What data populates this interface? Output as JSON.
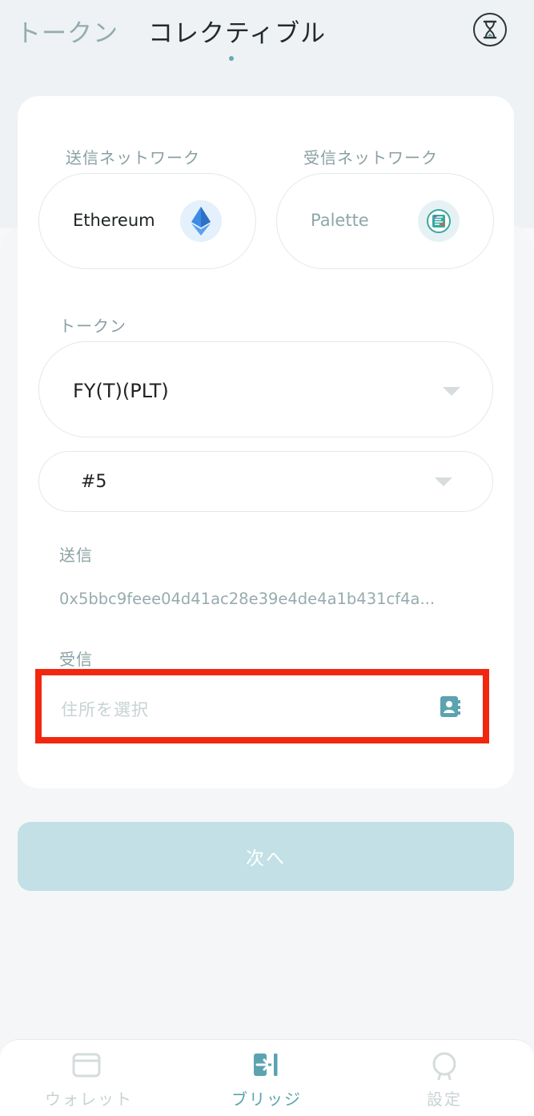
{
  "header": {
    "tabs": [
      {
        "label": "トークン",
        "active": false
      },
      {
        "label": "コレクティブル",
        "active": true
      }
    ],
    "history_icon": "hourglass-icon"
  },
  "bridge_form": {
    "send_network": {
      "label": "送信ネットワーク",
      "value": "Ethereum",
      "icon": "ethereum-icon"
    },
    "receive_network": {
      "label": "受信ネットワーク",
      "value": "Palette",
      "icon": "palette-icon"
    },
    "token": {
      "label": "トークン",
      "value": "FY(T)(PLT)"
    },
    "token_id": {
      "value": "#5"
    },
    "sender": {
      "label": "送信",
      "address": "0x5bbc9feee04d41ac28e39e4de4a1b431cf4a..."
    },
    "receiver": {
      "label": "受信",
      "placeholder": "住所を選択",
      "icon": "address-book-icon"
    }
  },
  "next_button": {
    "label": "次へ"
  },
  "bottom_nav": {
    "items": [
      {
        "label": "ウォレット",
        "icon": "wallet-icon",
        "active": false
      },
      {
        "label": "ブリッジ",
        "icon": "bridge-icon",
        "active": true
      },
      {
        "label": "設定",
        "icon": "settings-icon",
        "active": false
      }
    ]
  },
  "colors": {
    "accent": "#5ba3b0",
    "highlight_border": "#f2270f",
    "next_button_bg": "#c2e0e5",
    "ethereum_blue": "#3c8be6"
  }
}
